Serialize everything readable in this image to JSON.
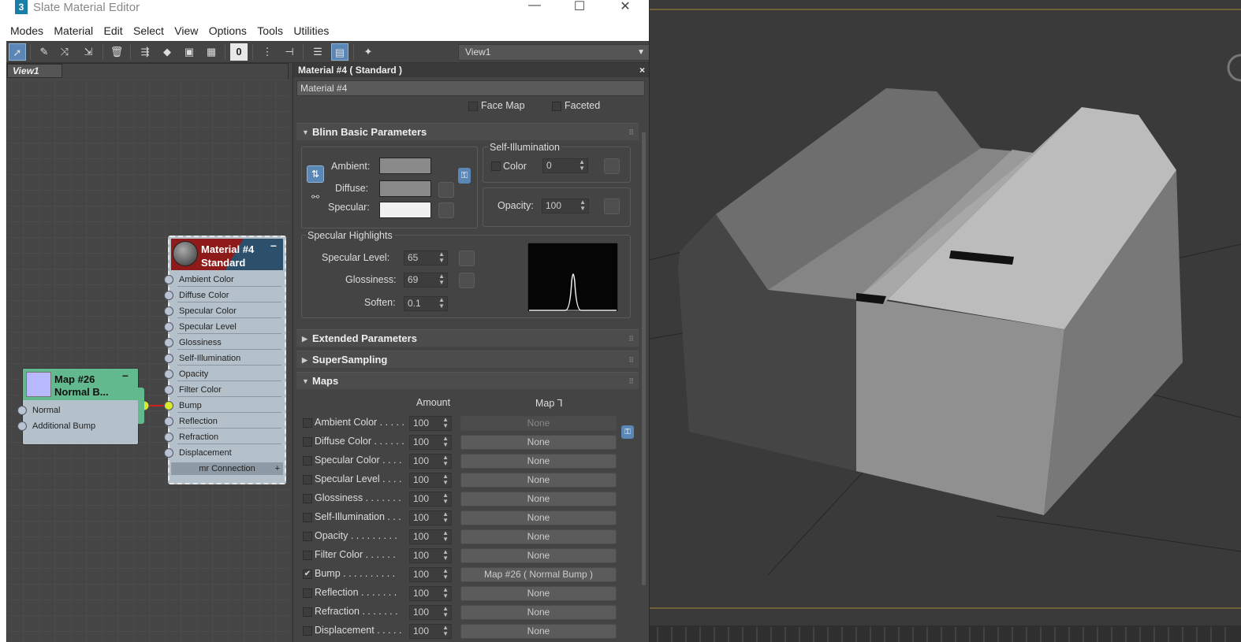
{
  "window": {
    "title": "Slate Material Editor",
    "app_icon": "3",
    "controls": {
      "minimize": "—",
      "maximize": "☐",
      "close": "✕"
    }
  },
  "menu": [
    "Modes",
    "Material",
    "Edit",
    "Select",
    "View",
    "Options",
    "Tools",
    "Utilities"
  ],
  "toolbar": {
    "view_selector": "View1",
    "number_icon": "0"
  },
  "node_view": {
    "tab": "View1",
    "map_node": {
      "title_line1": "Map #26",
      "title_line2": "Normal B...",
      "slots": [
        "Normal",
        "Additional Bump"
      ]
    },
    "material_node": {
      "title_line1": "Material #4",
      "title_line2": "Standard",
      "slots": [
        "Ambient Color",
        "Diffuse Color",
        "Specular Color",
        "Specular Level",
        "Glossiness",
        "Self-Illumination",
        "Opacity",
        "Filter Color",
        "Bump",
        "Reflection",
        "Refraction",
        "Displacement"
      ],
      "footer": "mr Connection"
    }
  },
  "params": {
    "header": "Material #4  ( Standard )",
    "name_field": "Material #4",
    "shader_opts": {
      "face_map": "Face Map",
      "faceted": "Faceted"
    },
    "blinn": {
      "title": "Blinn Basic Parameters",
      "ambient": "Ambient:",
      "diffuse": "Diffuse:",
      "specular": "Specular:",
      "self_illum_title": "Self-Illumination",
      "color_label": "Color",
      "color_value": "0",
      "opacity_label": "Opacity:",
      "opacity_value": "100",
      "spec_highlights": "Specular Highlights",
      "spec_level_label": "Specular Level:",
      "spec_level_value": "65",
      "gloss_label": "Glossiness:",
      "gloss_value": "69",
      "soften_label": "Soften:",
      "soften_value": "0.1"
    },
    "extended": "Extended Parameters",
    "supersampling": "SuperSampling",
    "maps": {
      "title": "Maps",
      "col_amount": "Amount",
      "col_map": "Map ⅂",
      "rows": [
        {
          "label": "Ambient Color . . . . .",
          "amount": "100",
          "map": "None",
          "checked": false
        },
        {
          "label": "Diffuse Color . . . . . .",
          "amount": "100",
          "map": "None",
          "checked": false
        },
        {
          "label": "Specular Color . . . .",
          "amount": "100",
          "map": "None",
          "checked": false
        },
        {
          "label": "Specular Level . . . .",
          "amount": "100",
          "map": "None",
          "checked": false
        },
        {
          "label": "Glossiness . . . . . . .",
          "amount": "100",
          "map": "None",
          "checked": false
        },
        {
          "label": "Self-Illumination . . .",
          "amount": "100",
          "map": "None",
          "checked": false
        },
        {
          "label": "Opacity . . . . . . . . .",
          "amount": "100",
          "map": "None",
          "checked": false
        },
        {
          "label": "Filter Color . . . . . .",
          "amount": "100",
          "map": "None",
          "checked": false
        },
        {
          "label": "Bump . . . . . . . . . .",
          "amount": "100",
          "map": "Map #26  ( Normal Bump )",
          "checked": true
        },
        {
          "label": "Reflection . . . . . . .",
          "amount": "100",
          "map": "None",
          "checked": false
        },
        {
          "label": "Refraction . . . . . . .",
          "amount": "100",
          "map": "None",
          "checked": false
        },
        {
          "label": "Displacement . . . . .",
          "amount": "100",
          "map": "None",
          "checked": false
        }
      ]
    }
  },
  "colors": {
    "ambient_swatch": "#8a8a8a",
    "diffuse_swatch": "#8a8a8a",
    "specular_swatch": "#f0f0f0",
    "map_node_header": "#5fb88a",
    "material_node_header": "#8f1a1a",
    "active_tool": "#5a87b5"
  }
}
